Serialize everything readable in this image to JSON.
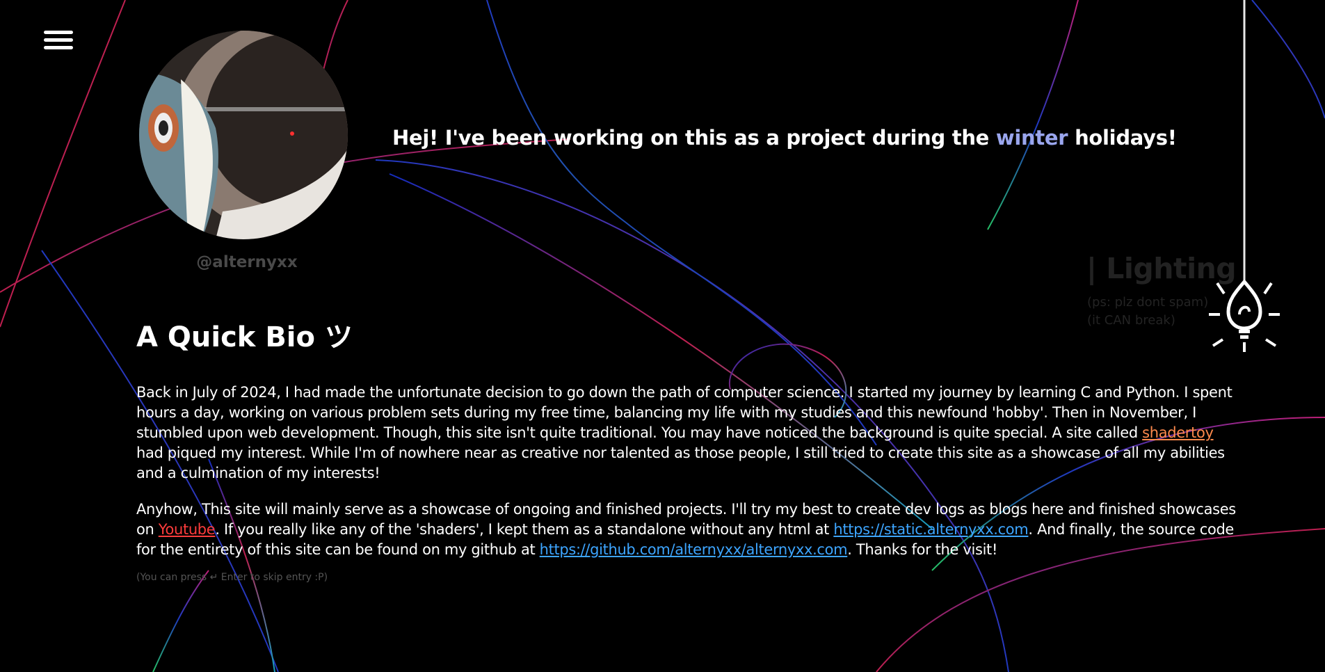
{
  "menu": {
    "icon": "hamburger-menu-icon"
  },
  "profile": {
    "handle": "@alternyxx"
  },
  "headline": {
    "before": "Hej! I've been working on this as a project during the ",
    "accent": "winter",
    "after": " holidays!",
    "accent_color": "#9aa6ee"
  },
  "lighting": {
    "title": "| Lighting",
    "note_line1": "(ps: plz dont spam)",
    "note_line2": "(it CAN break)",
    "icon": "light-bulb-icon"
  },
  "bio": {
    "title": "A Quick Bio ツ",
    "p1": {
      "text1": "Back in July of 2024, I had made the unfortunate decision to go down the path of computer science. I started my journey by learning C and Python. I spent hours a day, working on various problem sets during my free time, balancing my life with my studies and this newfound 'hobby'. Then in November, I stumbled upon web development. Though, this site isn't quite traditional. You may have noticed the background is quite special. A site called ",
      "link1": "shadertoy",
      "text2": " had piqued my interest. While I'm of nowhere near as creative nor talented as those people, I still tried to create this site as a showcase of all my abilities and a culmination of my interests!"
    },
    "p2": {
      "text1": "Anyhow, This site will mainly serve as a showcase of ongoing and finished projects. I'll try my best to create dev logs as blogs here and finished showcases on ",
      "link1": "Youtube",
      "text2": ". If you really like any of the 'shaders', I kept them as a standalone without any html at ",
      "link2": "https://static.alternyxx.com",
      "text3": ". And finally, the source code for the entirety of this site can be found on my github at ",
      "link3": "https://github.com/alternyxx/alternyxx.com",
      "text4": ". Thanks for the visit!"
    },
    "hint": "(You can press ↵ Enter to skip entry :P)"
  },
  "colors": {
    "background": "#000000",
    "link_orange": "#ff8a4d",
    "link_red": "#ff3c3c",
    "link_blue": "#3da5ff"
  }
}
